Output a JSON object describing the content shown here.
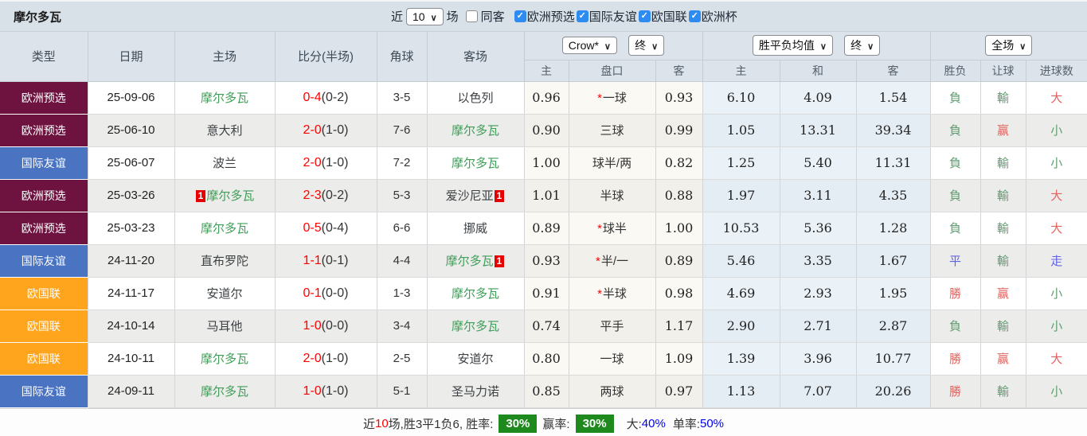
{
  "title": "摩尔多瓦",
  "topbar": {
    "recent_label": "近",
    "matches_count": "10",
    "matches_label": "场",
    "same_away_label": "同客",
    "same_away_checked": false,
    "leagues": [
      {
        "label": "欧洲预选",
        "checked": true
      },
      {
        "label": "国际友谊",
        "checked": true
      },
      {
        "label": "欧国联",
        "checked": true
      },
      {
        "label": "欧洲杯",
        "checked": true
      }
    ]
  },
  "header": {
    "left_cols": [
      "类型",
      "日期",
      "主场",
      "比分(半场)",
      "角球",
      "客场"
    ],
    "selects": {
      "company": "Crow*",
      "company_time": "终",
      "avg": "胜平负均值",
      "avg_time": "终",
      "scope": "全场"
    },
    "sub_cols": [
      "主",
      "盘口",
      "客",
      "主",
      "和",
      "客",
      "胜负",
      "让球",
      "进球数"
    ]
  },
  "rows": [
    {
      "type": "欧洲预选",
      "type_key": "maroon",
      "date": "25-09-06",
      "home": {
        "name": "摩尔多瓦",
        "green": true
      },
      "score": {
        "full": "0-4",
        "half": "(0-2)"
      },
      "corner": "3-5",
      "away": {
        "name": "以色列",
        "green": false
      },
      "odds": {
        "home": "0.96",
        "star": "*",
        "handicap": "一球",
        "away": "0.93"
      },
      "avg": {
        "home": "6.10",
        "draw": "4.09",
        "away": "1.54"
      },
      "results": {
        "outcome": {
          "t": "負",
          "c": "green"
        },
        "cover": {
          "t": "輸",
          "c": "green"
        },
        "goals": {
          "t": "大",
          "c": "red"
        }
      }
    },
    {
      "type": "欧洲预选",
      "type_key": "maroon",
      "date": "25-06-10",
      "home": {
        "name": "意大利",
        "green": false
      },
      "score": {
        "full": "2-0",
        "half": "(1-0)"
      },
      "corner": "7-6",
      "away": {
        "name": "摩尔多瓦",
        "green": true
      },
      "odds": {
        "home": "0.90",
        "star": "",
        "handicap": "三球",
        "away": "0.99"
      },
      "avg": {
        "home": "1.05",
        "draw": "13.31",
        "away": "39.34"
      },
      "results": {
        "outcome": {
          "t": "負",
          "c": "green"
        },
        "cover": {
          "t": "赢",
          "c": "red"
        },
        "goals": {
          "t": "小",
          "c": "green"
        }
      }
    },
    {
      "type": "国际友谊",
      "type_key": "blue",
      "date": "25-06-07",
      "home": {
        "name": "波兰",
        "green": false
      },
      "score": {
        "full": "2-0",
        "half": "(1-0)"
      },
      "corner": "7-2",
      "away": {
        "name": "摩尔多瓦",
        "green": true
      },
      "odds": {
        "home": "1.00",
        "star": "",
        "handicap": "球半/两",
        "away": "0.82"
      },
      "avg": {
        "home": "1.25",
        "draw": "5.40",
        "away": "11.31"
      },
      "results": {
        "outcome": {
          "t": "負",
          "c": "green"
        },
        "cover": {
          "t": "輸",
          "c": "green"
        },
        "goals": {
          "t": "小",
          "c": "green"
        }
      }
    },
    {
      "type": "欧洲预选",
      "type_key": "maroon",
      "date": "25-03-26",
      "home": {
        "name": "摩尔多瓦",
        "green": true,
        "card_pre": "1"
      },
      "score": {
        "full": "2-3",
        "half": "(0-2)"
      },
      "corner": "5-3",
      "away": {
        "name": "爱沙尼亚",
        "green": false,
        "card_post": "1"
      },
      "odds": {
        "home": "1.01",
        "star": "",
        "handicap": "半球",
        "away": "0.88"
      },
      "avg": {
        "home": "1.97",
        "draw": "3.11",
        "away": "4.35"
      },
      "results": {
        "outcome": {
          "t": "負",
          "c": "green"
        },
        "cover": {
          "t": "輸",
          "c": "green"
        },
        "goals": {
          "t": "大",
          "c": "red"
        }
      }
    },
    {
      "type": "欧洲预选",
      "type_key": "maroon",
      "date": "25-03-23",
      "home": {
        "name": "摩尔多瓦",
        "green": true
      },
      "score": {
        "full": "0-5",
        "half": "(0-4)"
      },
      "corner": "6-6",
      "away": {
        "name": "挪威",
        "green": false
      },
      "odds": {
        "home": "0.89",
        "star": "*",
        "handicap": "球半",
        "away": "1.00"
      },
      "avg": {
        "home": "10.53",
        "draw": "5.36",
        "away": "1.28"
      },
      "results": {
        "outcome": {
          "t": "負",
          "c": "green"
        },
        "cover": {
          "t": "輸",
          "c": "green"
        },
        "goals": {
          "t": "大",
          "c": "red"
        }
      }
    },
    {
      "type": "国际友谊",
      "type_key": "blue",
      "date": "24-11-20",
      "home": {
        "name": "直布罗陀",
        "green": false
      },
      "score": {
        "full": "1-1",
        "half": "(0-1)"
      },
      "corner": "4-4",
      "away": {
        "name": "摩尔多瓦",
        "green": true,
        "card_post": "1"
      },
      "odds": {
        "home": "0.93",
        "star": "*",
        "handicap": "半/一",
        "away": "0.89"
      },
      "avg": {
        "home": "5.46",
        "draw": "3.35",
        "away": "1.67"
      },
      "results": {
        "outcome": {
          "t": "平",
          "c": "blue"
        },
        "cover": {
          "t": "輸",
          "c": "green"
        },
        "goals": {
          "t": "走",
          "c": "blue"
        }
      }
    },
    {
      "type": "欧国联",
      "type_key": "orange",
      "date": "24-11-17",
      "home": {
        "name": "安道尔",
        "green": false
      },
      "score": {
        "full": "0-1",
        "half": "(0-0)"
      },
      "corner": "1-3",
      "away": {
        "name": "摩尔多瓦",
        "green": true
      },
      "odds": {
        "home": "0.91",
        "star": "*",
        "handicap": "半球",
        "away": "0.98"
      },
      "avg": {
        "home": "4.69",
        "draw": "2.93",
        "away": "1.95"
      },
      "results": {
        "outcome": {
          "t": "勝",
          "c": "red"
        },
        "cover": {
          "t": "赢",
          "c": "red"
        },
        "goals": {
          "t": "小",
          "c": "green"
        }
      }
    },
    {
      "type": "欧国联",
      "type_key": "orange",
      "date": "24-10-14",
      "home": {
        "name": "马耳他",
        "green": false
      },
      "score": {
        "full": "1-0",
        "half": "(0-0)"
      },
      "corner": "3-4",
      "away": {
        "name": "摩尔多瓦",
        "green": true
      },
      "odds": {
        "home": "0.74",
        "star": "",
        "handicap": "平手",
        "away": "1.17"
      },
      "avg": {
        "home": "2.90",
        "draw": "2.71",
        "away": "2.87"
      },
      "results": {
        "outcome": {
          "t": "負",
          "c": "green"
        },
        "cover": {
          "t": "輸",
          "c": "green"
        },
        "goals": {
          "t": "小",
          "c": "green"
        }
      }
    },
    {
      "type": "欧国联",
      "type_key": "orange",
      "date": "24-10-11",
      "home": {
        "name": "摩尔多瓦",
        "green": true
      },
      "score": {
        "full": "2-0",
        "half": "(1-0)"
      },
      "corner": "2-5",
      "away": {
        "name": "安道尔",
        "green": false
      },
      "odds": {
        "home": "0.80",
        "star": "",
        "handicap": "一球",
        "away": "1.09"
      },
      "avg": {
        "home": "1.39",
        "draw": "3.96",
        "away": "10.77"
      },
      "results": {
        "outcome": {
          "t": "勝",
          "c": "red"
        },
        "cover": {
          "t": "赢",
          "c": "red"
        },
        "goals": {
          "t": "大",
          "c": "red"
        }
      }
    },
    {
      "type": "国际友谊",
      "type_key": "blue",
      "date": "24-09-11",
      "home": {
        "name": "摩尔多瓦",
        "green": true
      },
      "score": {
        "full": "1-0",
        "half": "(1-0)"
      },
      "corner": "5-1",
      "away": {
        "name": "圣马力诺",
        "green": false
      },
      "odds": {
        "home": "0.85",
        "star": "",
        "handicap": "两球",
        "away": "0.97"
      },
      "avg": {
        "home": "1.13",
        "draw": "7.07",
        "away": "20.26"
      },
      "results": {
        "outcome": {
          "t": "勝",
          "c": "red"
        },
        "cover": {
          "t": "輸",
          "c": "green"
        },
        "goals": {
          "t": "小",
          "c": "green"
        }
      }
    }
  ],
  "summary": {
    "recent_label": "近",
    "recent_count": "10",
    "stats_text": "场,胜3平1负6, 胜率:",
    "win_rate": "30%",
    "cover_label": "赢率:",
    "cover_rate": "30%",
    "big_label": "大:",
    "big_rate": "40%",
    "single_label": "单率:",
    "single_rate": "50%"
  },
  "colors": {
    "type_maroon": "#6e1240",
    "type_blue": "#4a73c2",
    "type_orange": "#ffa41d",
    "team_green": "#3f9e58",
    "score_red": "#ff0000",
    "result_red": "#e2635f",
    "result_green": "#5f9e70",
    "result_blue": "#6262e8",
    "badge_green": "#1e8a1e",
    "percent_blue": "#0000ee",
    "card_red": "#e60000",
    "checkbox_blue": "#2e8bf0"
  }
}
